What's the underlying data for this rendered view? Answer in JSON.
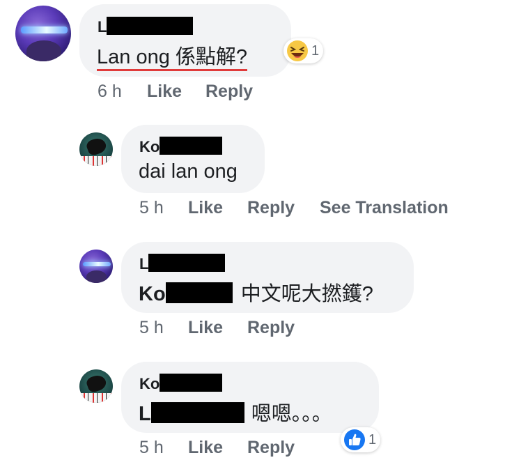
{
  "comments": [
    {
      "author_visible": "L",
      "text": "Lan ong 係點解?",
      "reaction": {
        "icon": "haha-icon",
        "count": "1"
      },
      "time": "6 h",
      "like": "Like",
      "reply": "Reply"
    },
    {
      "author_visible": "Ko",
      "text": "dai lan ong",
      "time": "5 h",
      "like": "Like",
      "reply": "Reply",
      "see_translation": "See Translation"
    },
    {
      "author_visible": "L",
      "mention_visible": "Ko",
      "text": "中文呢大撚鑊?",
      "time": "5 h",
      "like": "Like",
      "reply": "Reply"
    },
    {
      "author_visible": "Ko",
      "mention_visible": "L",
      "text": "嗯嗯。。。",
      "reaction": {
        "icon": "like-icon",
        "count": "1"
      },
      "time": "5 h",
      "like": "Like",
      "reply": "Reply"
    }
  ],
  "colors": {
    "bubble": "#f2f3f5",
    "meta": "#606770",
    "like_blue": "#1877f2",
    "haha_yellow": "#f7c845",
    "underline_red": "#e03b3b"
  }
}
